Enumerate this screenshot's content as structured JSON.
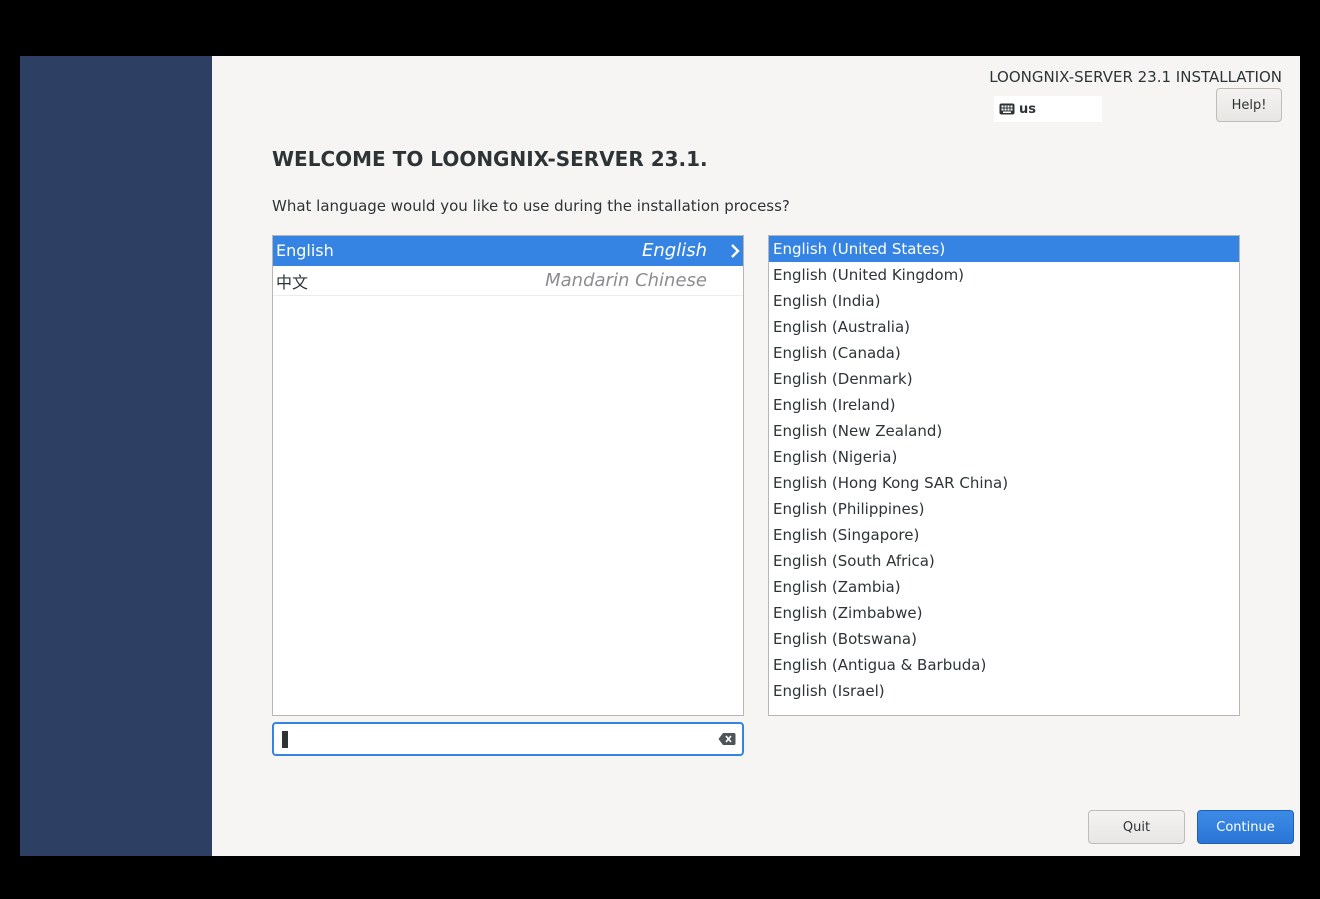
{
  "header": {
    "product_title": "LOONGNIX-SERVER 23.1 INSTALLATION",
    "keyboard_layout": "us",
    "help_label": "Help!"
  },
  "welcome": {
    "heading": "WELCOME TO LOONGNIX-SERVER 23.1.",
    "prompt": "What language would you like to use during the installation process?"
  },
  "languages": [
    {
      "native": "English",
      "english": "English",
      "selected": true
    },
    {
      "native": "中文",
      "english": "Mandarin Chinese",
      "selected": false
    }
  ],
  "locales": [
    "English (United States)",
    "English (United Kingdom)",
    "English (India)",
    "English (Australia)",
    "English (Canada)",
    "English (Denmark)",
    "English (Ireland)",
    "English (New Zealand)",
    "English (Nigeria)",
    "English (Hong Kong SAR China)",
    "English (Philippines)",
    "English (Singapore)",
    "English (South Africa)",
    "English (Zambia)",
    "English (Zimbabwe)",
    "English (Botswana)",
    "English (Antigua & Barbuda)",
    "English (Israel)"
  ],
  "selected_locale": "English (United States)",
  "search": {
    "value": "",
    "placeholder": ""
  },
  "footer": {
    "quit_label": "Quit",
    "continue_label": "Continue"
  },
  "colors": {
    "sidebar": "#2d3f63",
    "accent": "#3584e4",
    "window_bg": "#f6f5f4"
  }
}
